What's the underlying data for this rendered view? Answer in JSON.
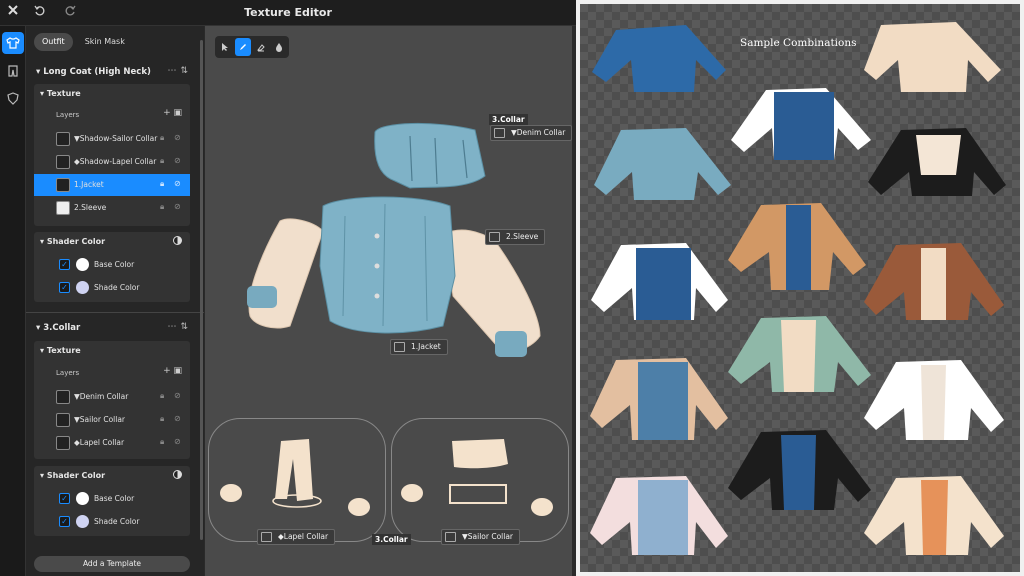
{
  "app": {
    "title": "Texture Editor"
  },
  "topbar": {
    "close_icon": "close-icon",
    "undo_icon": "undo-icon",
    "redo_icon": "redo-icon"
  },
  "rail": {
    "items": [
      "shirt-icon",
      "pants-icon",
      "shield-icon"
    ]
  },
  "tabs": [
    "Outfit",
    "Skin Mask"
  ],
  "sections": [
    {
      "title": "Long Coat (High Neck)",
      "texture_label": "Texture",
      "layers_label": "Layers",
      "layers": [
        {
          "label": "▼Shadow-Sailor Collar",
          "selected": false
        },
        {
          "label": "◆Shadow-Lapel Collar",
          "selected": false
        },
        {
          "label": "1.Jacket",
          "selected": true
        },
        {
          "label": "2.Sleeve",
          "selected": false
        }
      ],
      "shader_label": "Shader Color",
      "shades": [
        {
          "label": "Base Color",
          "color": "#ffffff"
        },
        {
          "label": "Shade Color",
          "color": "#cfd3f2"
        }
      ]
    },
    {
      "title": "3.Collar",
      "texture_label": "Texture",
      "layers_label": "Layers",
      "layers": [
        {
          "label": "▼Denim Collar",
          "selected": false
        },
        {
          "label": "▼Sailor Collar",
          "selected": false
        },
        {
          "label": "◆Lapel Collar",
          "selected": false
        }
      ],
      "shader_label": "Shader Color",
      "shades": [
        {
          "label": "Base Color",
          "color": "#ffffff"
        },
        {
          "label": "Shade Color",
          "color": "#cfd3f2"
        }
      ]
    }
  ],
  "add_template": "Add a Template",
  "canvas": {
    "tags": {
      "collar_title": "3.Collar",
      "denim_collar": "▼Denim Collar",
      "sleeve": "2.Sleeve",
      "jacket": "1.Jacket",
      "lapel_collar": "◆Lapel Collar",
      "collar_bottom": "3.Collar",
      "sailor_collar": "▼Sailor Collar"
    }
  },
  "preview": {
    "title": "Sample Combinations"
  },
  "colors": {
    "accent": "#1a8cff",
    "denim": "#5f9fb4",
    "cream": "#f4e2cc"
  }
}
